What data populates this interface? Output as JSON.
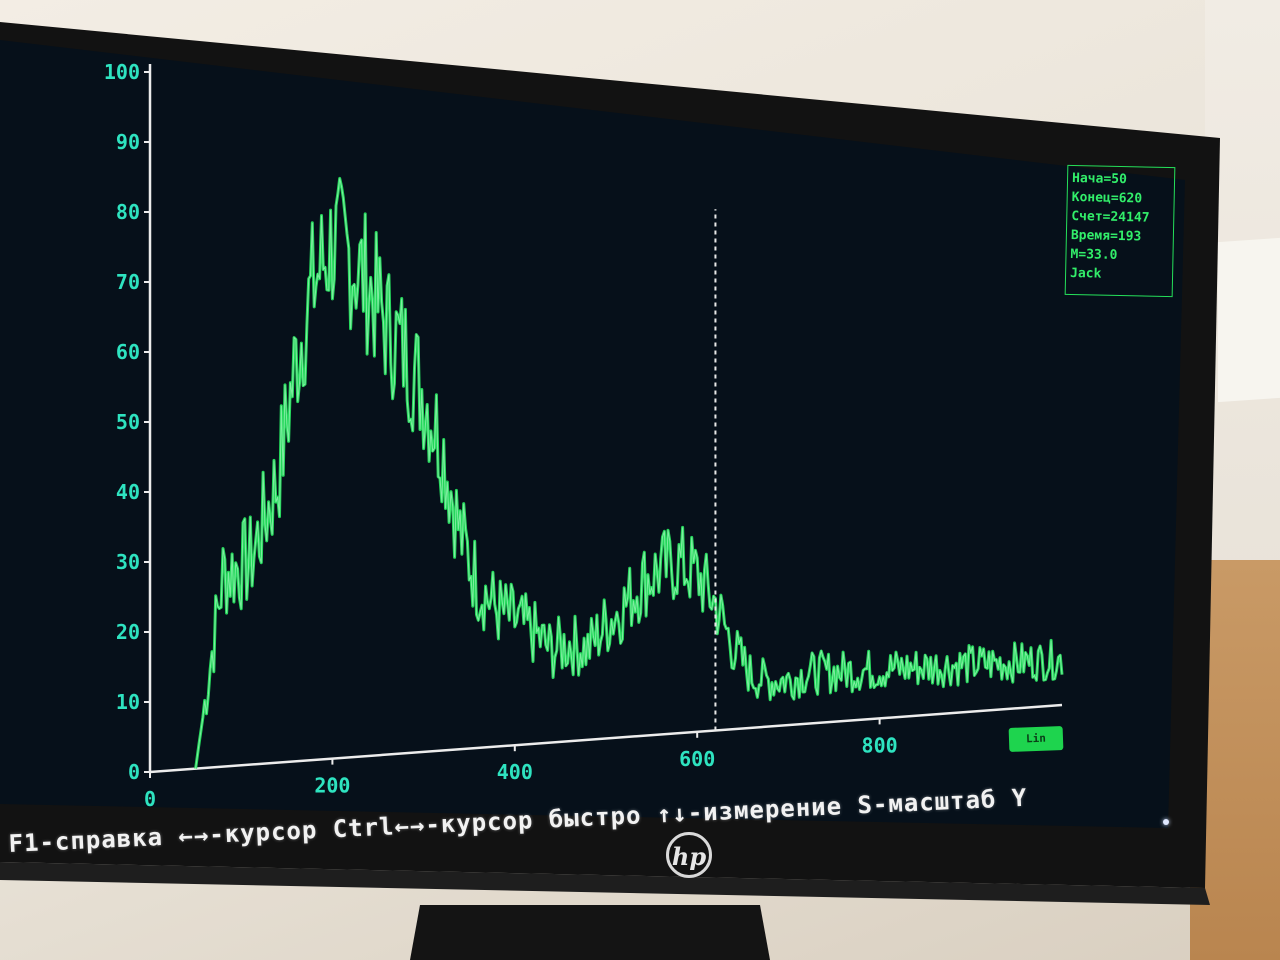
{
  "scene": {
    "description_tag": "photo-of-monitor",
    "monitor_brand": "hp"
  },
  "colors": {
    "screen_bg": "#07101a",
    "spectrum": "#26e35f",
    "axis_labels": "#2ee3c0",
    "axis_line": "#ececec",
    "cursor": "#e8e8e8",
    "status_text": "#f2f2f2"
  },
  "chart_data": {
    "type": "line",
    "y_ticks": [
      "0",
      "10",
      "20",
      "30",
      "40",
      "50",
      "60",
      "70",
      "80",
      "90",
      "100"
    ],
    "x_ticks": [
      "0",
      "200",
      "400",
      "600",
      "800"
    ],
    "ylim": [
      0,
      100
    ],
    "xlim": [
      0,
      1000
    ],
    "cursor_x": 620,
    "series": [
      {
        "x": [
          50,
          80,
          110,
          140,
          160,
          180,
          200,
          220,
          240,
          260,
          280,
          300,
          320,
          340,
          360,
          380,
          400,
          420,
          440,
          460,
          480,
          500,
          520,
          540,
          560,
          580,
          600,
          620,
          640,
          660,
          680,
          700,
          720,
          760,
          800,
          850,
          900,
          950,
          1000
        ],
        "values": [
          0,
          28,
          30,
          42,
          60,
          72,
          78,
          76,
          72,
          66,
          62,
          56,
          48,
          34,
          26,
          22,
          20,
          18,
          15,
          16,
          15,
          19,
          22,
          26,
          28,
          29,
          27,
          22,
          14,
          9,
          8,
          8,
          9,
          9,
          9,
          9,
          9,
          9,
          9
        ]
      }
    ]
  },
  "info_panel": {
    "lines": [
      "Нача=50",
      "Конец=620",
      "Счет=24147",
      "Время=193",
      "М=33.0",
      "Jack"
    ]
  },
  "mode_badge": {
    "label": "Lin"
  },
  "status_bar": {
    "text": "F1-справка ←→-курсор Ctrl←→-курсор быстро ↑↓-измерение S-масштаб Y"
  }
}
